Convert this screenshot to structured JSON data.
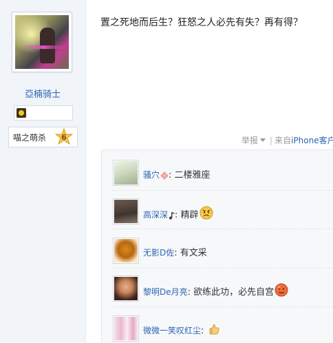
{
  "author": {
    "name": "亞楠骑士",
    "level_name": "喵之萌杀",
    "level_number": "6"
  },
  "post": {
    "content": "置之死地而后生？狂怒之人必先有失？再有得？",
    "report_label": "举报",
    "separator": "|",
    "source_prefix": "来自",
    "client_name": "iPhone客户"
  },
  "replies": [
    {
      "user": "骚穴",
      "colon": ":",
      "text": "二楼雅座",
      "user_emoji": "flower-icon",
      "end_emoji": ""
    },
    {
      "user": "高深深",
      "colon": ":",
      "text": "精辟",
      "user_emoji": "music-note-icon",
      "end_emoji": "angry-face-emoji"
    },
    {
      "user": "无影D佐",
      "colon": ":",
      "text": "有文采",
      "user_emoji": "",
      "end_emoji": ""
    },
    {
      "user": "黎明De月亮",
      "colon": ":",
      "text": "欲练此功，必先自宫",
      "user_emoji": "",
      "end_emoji": "red-face-emoji"
    },
    {
      "user": "微微一笑叹红尘",
      "colon": ":",
      "text": "",
      "user_emoji": "",
      "end_emoji": "thumbs-up-emoji"
    }
  ],
  "colors": {
    "link_blue": "#2d64b3",
    "sidebar_bg": "#f1f4f9",
    "reply_bg": "#f7f8fa"
  }
}
